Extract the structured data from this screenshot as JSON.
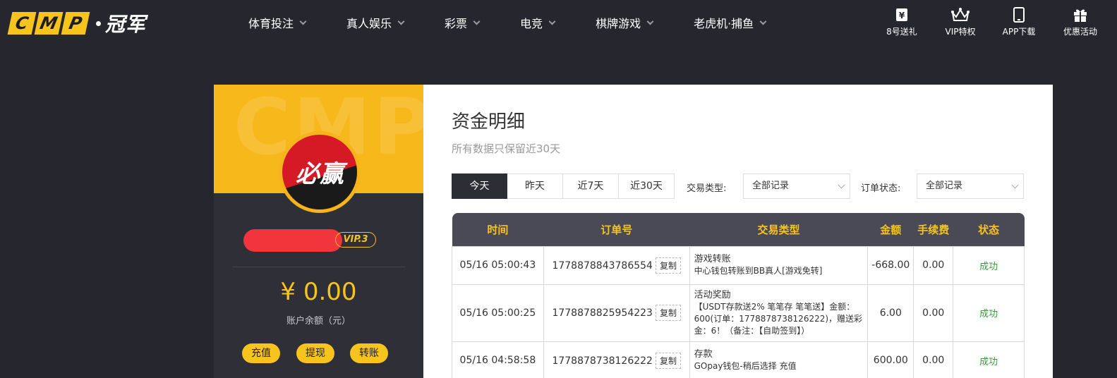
{
  "brand": {
    "letters": [
      "C",
      "M",
      "P"
    ],
    "name": "冠军"
  },
  "nav": [
    {
      "label": "体育投注"
    },
    {
      "label": "真人娱乐"
    },
    {
      "label": "彩票"
    },
    {
      "label": "电竞"
    },
    {
      "label": "棋牌游戏"
    },
    {
      "label": "老虎机·捕鱼"
    }
  ],
  "quick": [
    {
      "label": "8号送礼",
      "icon": "ticket-yen-icon"
    },
    {
      "label": "VIP特权",
      "icon": "crown-icon"
    },
    {
      "label": "APP下载",
      "icon": "phone-icon"
    },
    {
      "label": "优惠活动",
      "icon": "gift-icon"
    }
  ],
  "account": {
    "banner_watermark": "CMP",
    "avatar_text": "必赢",
    "vip": "VIP.3",
    "balance": "¥ 0.00",
    "balance_label": "账户余额（元）",
    "actions": [
      "充值",
      "提现",
      "转账"
    ]
  },
  "page": {
    "title": "资金明细",
    "subtitle": "所有数据只保留近30天"
  },
  "filters": {
    "ranges": [
      "今天",
      "昨天",
      "近7天",
      "近30天"
    ],
    "active_range": "今天",
    "type_label": "交易类型:",
    "type_value": "全部记录",
    "status_label": "订单状态:",
    "status_value": "全部记录"
  },
  "table": {
    "headers": [
      "时间",
      "订单号",
      "交易类型",
      "金额",
      "手续费",
      "状态"
    ],
    "copy_label": "复制",
    "rows": [
      {
        "time": "05/16 05:00:43",
        "order": "1778878843786554",
        "type_title": "游戏转账",
        "type_detail": "中心钱包转账到BB真人[游戏免转]",
        "amount": "-668.00",
        "fee": "0.00",
        "status": "成功"
      },
      {
        "time": "05/16 05:00:25",
        "order": "1778878825954223",
        "type_title": "活动奖励",
        "type_detail": "【USDT存款送2% 笔笔存 笔笔送】金额：600(订单：1778878738126222)，赠送彩金：6！（备注：【自助签到】）",
        "amount": "6.00",
        "fee": "0.00",
        "status": "成功"
      },
      {
        "time": "05/16 04:58:58",
        "order": "1778878738126222",
        "type_title": "存款",
        "type_detail": "GOpay钱包-稍后选择 充值",
        "amount": "600.00",
        "fee": "0.00",
        "status": "成功"
      }
    ]
  },
  "colors": {
    "accent": "#f7c31d",
    "dark": "#26262e",
    "header": "#4a4a56",
    "success": "#3a9a3a",
    "redact": "#f0363c"
  }
}
